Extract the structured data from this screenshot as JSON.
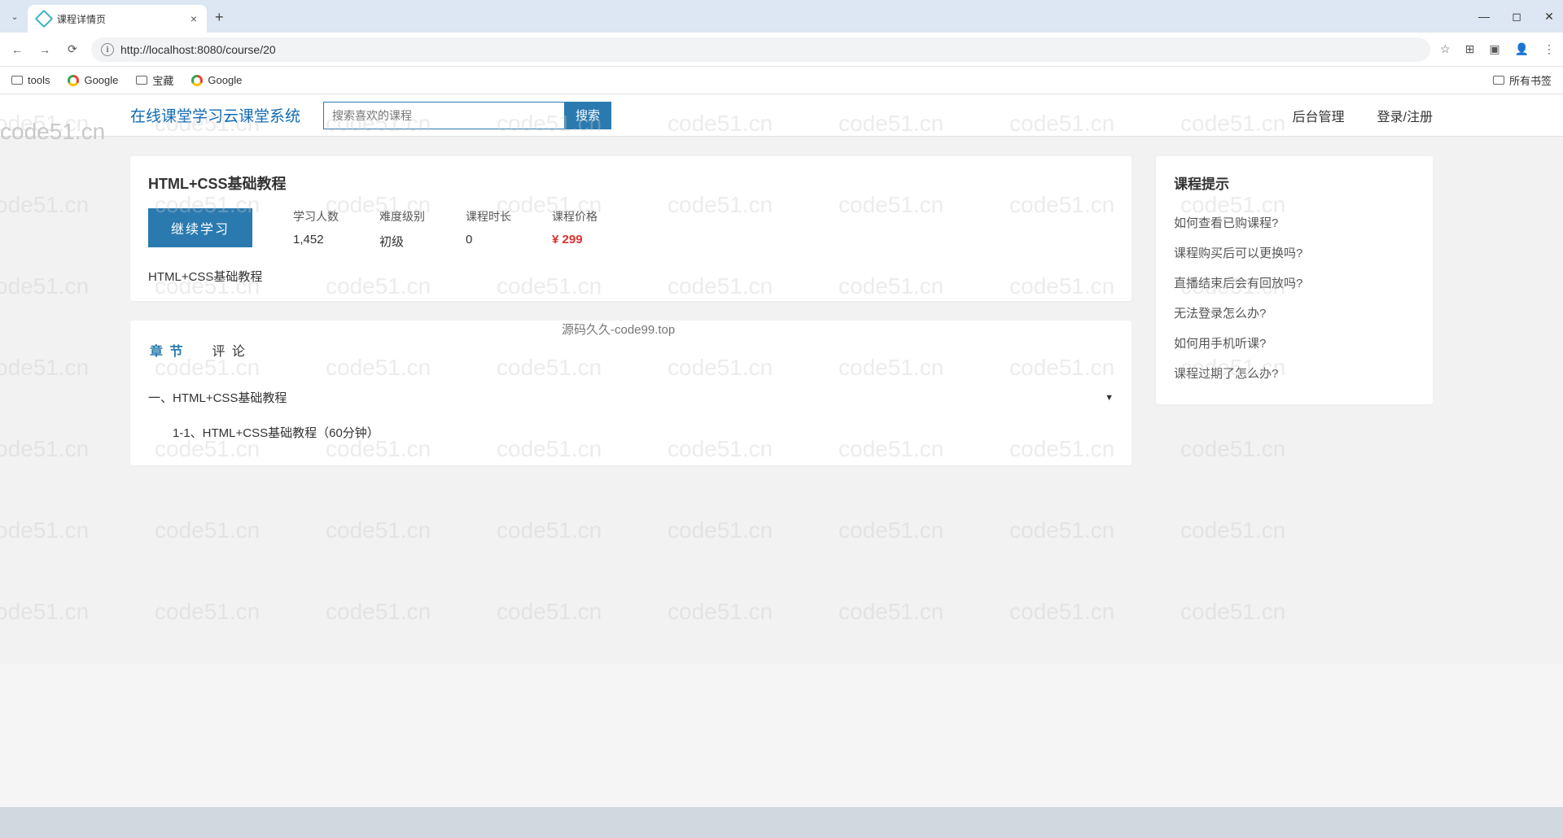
{
  "browser": {
    "tab_title": "课程详情页",
    "url": "http://localhost:8080/course/20",
    "bookmarks": [
      "tools",
      "Google",
      "宝藏",
      "Google"
    ],
    "all_bookmarks": "所有书签"
  },
  "header": {
    "brand": "在线课堂学习云课堂系统",
    "search_placeholder": "搜索喜欢的课程",
    "search_btn": "搜索",
    "nav_admin": "后台管理",
    "nav_login": "登录/注册"
  },
  "course": {
    "title": "HTML+CSS基础教程",
    "action_btn": "继续学习",
    "stats": {
      "students_label": "学习人数",
      "students_value": "1,452",
      "level_label": "难度级别",
      "level_value": "初级",
      "duration_label": "课程时长",
      "duration_value": "0",
      "price_label": "课程价格",
      "price_value": "¥ 299"
    },
    "description": "HTML+CSS基础教程"
  },
  "tabs": {
    "chapter": "章 节",
    "comment": "评 论"
  },
  "chapters": {
    "c1_title": "一、HTML+CSS基础教程",
    "c1_l1": "1-1、HTML+CSS基础教程（60分钟）"
  },
  "sidebar": {
    "title": "课程提示",
    "faq": [
      "如何查看已购课程?",
      "课程购买后可以更换吗?",
      "直播结束后会有回放吗?",
      "无法登录怎么办?",
      "如何用手机听课?",
      "课程过期了怎么办?"
    ]
  },
  "marks": {
    "wm": "code51.cn",
    "center": "源码久久-code99.top"
  }
}
